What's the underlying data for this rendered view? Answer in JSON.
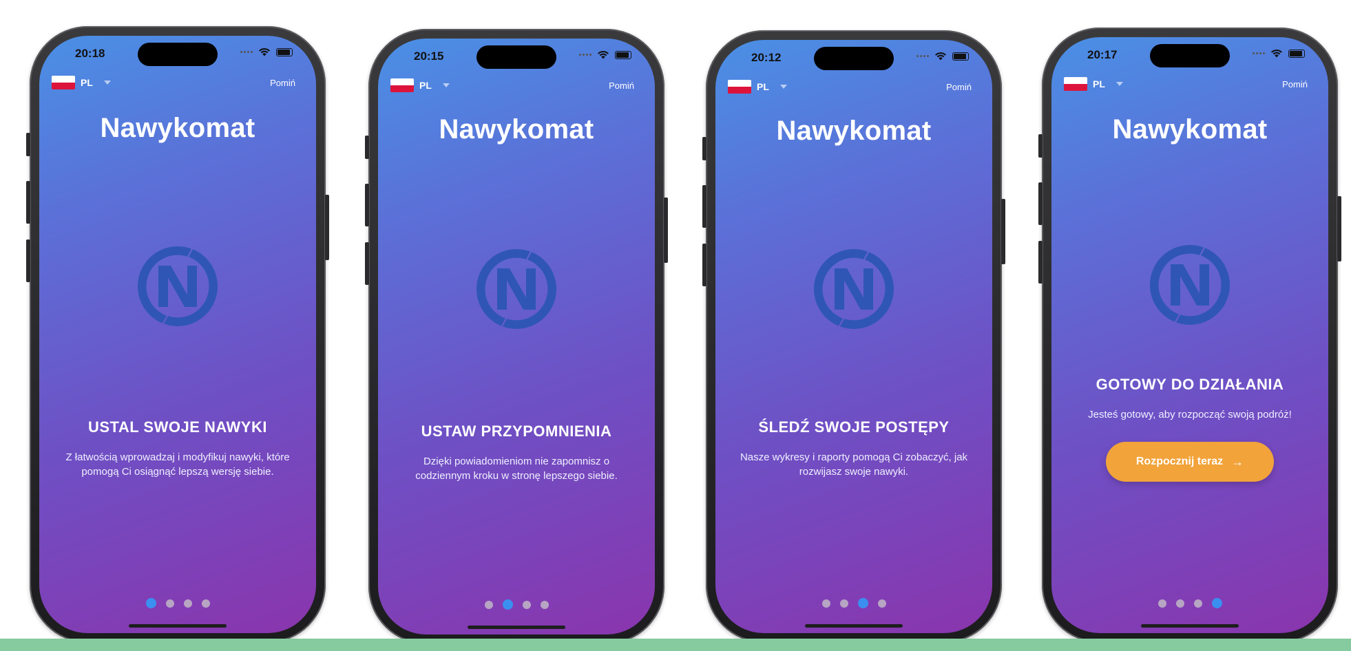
{
  "colors": {
    "gradient_top": "#4a90e5",
    "gradient_bottom": "#8a35ad",
    "logo": "#2f56b5",
    "cta": "#f2a33a",
    "pager_active": "#3b8ff0",
    "pager_inactive": "#c8c8c8",
    "band": "#86cba0"
  },
  "screens": [
    {
      "time": "20:18",
      "language": {
        "flag": "poland-flag-icon",
        "code": "PL"
      },
      "skip_label": "Pomiń",
      "app_title": "Nawykomat",
      "slide_title": "USTAL SWOJE NAWYKI",
      "slide_description": "Z łatwością wprowadzaj i modyfikuj nawyki, które pomogą Ci osiągnąć lepszą wersję siebie.",
      "page_index": 1,
      "page_count": 4
    },
    {
      "time": "20:15",
      "language": {
        "flag": "poland-flag-icon",
        "code": "PL"
      },
      "skip_label": "Pomiń",
      "app_title": "Nawykomat",
      "slide_title": "USTAW PRZYPOMNIENIA",
      "slide_description": "Dzięki powiadomieniom nie zapomnisz o codziennym kroku w stronę lepszego siebie.",
      "page_index": 2,
      "page_count": 4
    },
    {
      "time": "20:12",
      "language": {
        "flag": "poland-flag-icon",
        "code": "PL"
      },
      "skip_label": "Pomiń",
      "app_title": "Nawykomat",
      "slide_title": "ŚLEDŹ SWOJE POSTĘPY",
      "slide_description": "Nasze wykresy i raporty pomogą Ci zobaczyć, jak rozwijasz swoje nawyki.",
      "page_index": 3,
      "page_count": 4
    },
    {
      "time": "20:17",
      "language": {
        "flag": "poland-flag-icon",
        "code": "PL"
      },
      "skip_label": "Pomiń",
      "app_title": "Nawykomat",
      "slide_title": "GOTOWY DO DZIAŁANIA",
      "slide_description": "Jesteś gotowy, aby rozpocząć swoją podróż!",
      "cta_label": "Rozpocznij teraz",
      "cta_icon": "arrow-right-icon",
      "page_index": 4,
      "page_count": 4
    }
  ]
}
